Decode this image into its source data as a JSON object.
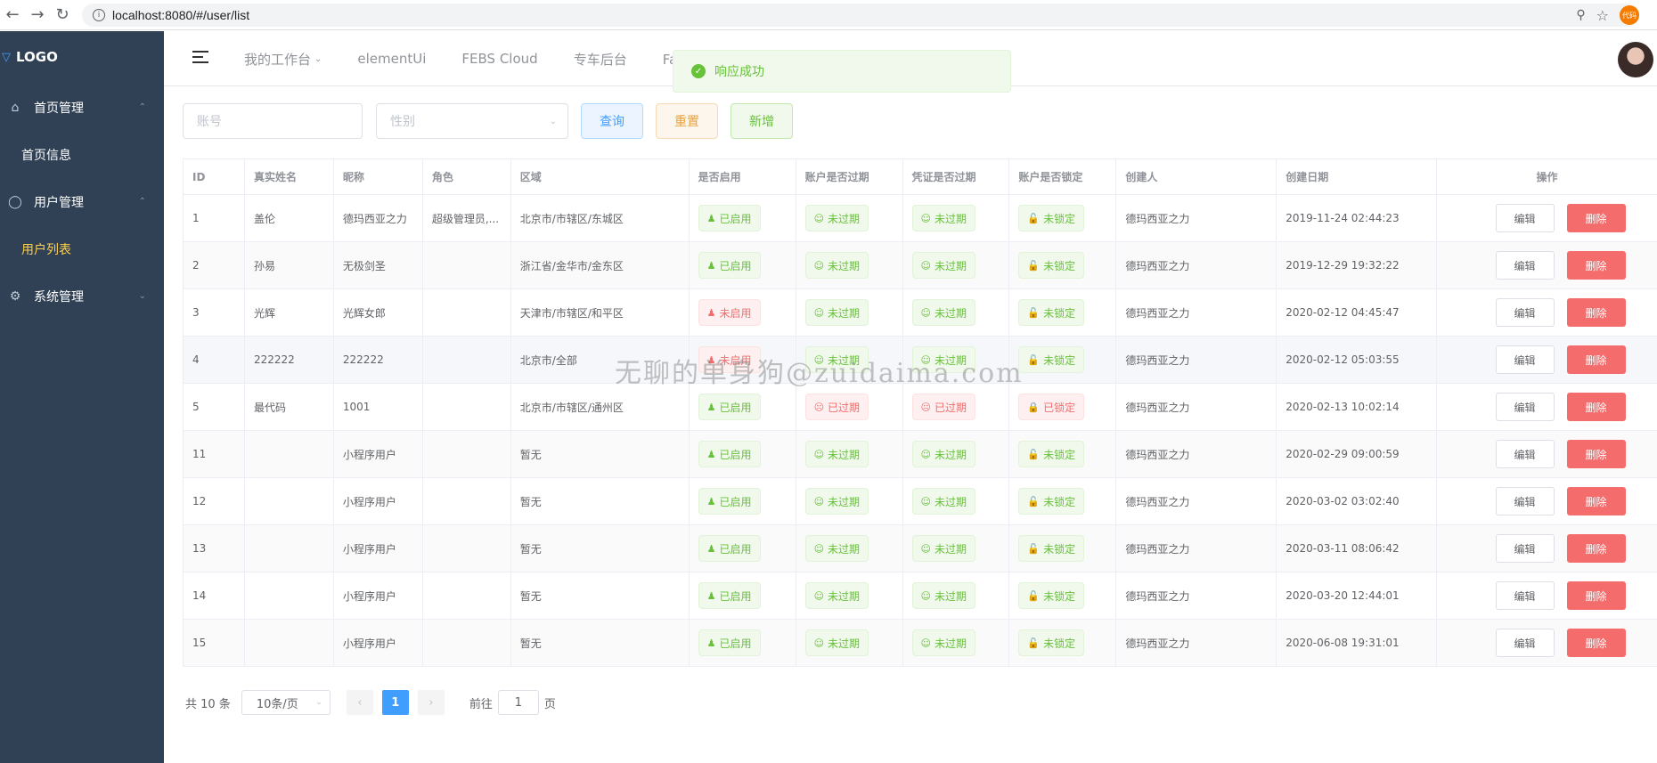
{
  "browser": {
    "url": "localhost:8080/#/user/list",
    "ext_label": "代码"
  },
  "sidebar": {
    "logo": "LOGO",
    "groups": [
      {
        "label": "首页管理",
        "items": [
          "首页信息"
        ]
      },
      {
        "label": "用户管理",
        "items": [
          "用户列表"
        ]
      },
      {
        "label": "系统管理",
        "items": []
      }
    ],
    "active_item": "用户列表"
  },
  "header": {
    "nav": [
      "我的工作台",
      "elementUi",
      "FEBS Cloud",
      "专车后台",
      "Fa图"
    ]
  },
  "toast": {
    "message": "响应成功"
  },
  "search": {
    "account_placeholder": "账号",
    "gender_placeholder": "性别",
    "query_label": "查询",
    "reset_label": "重置",
    "add_label": "新增"
  },
  "table": {
    "columns": [
      "ID",
      "真实姓名",
      "昵称",
      "角色",
      "区域",
      "是否启用",
      "账户是否过期",
      "凭证是否过期",
      "账户是否锁定",
      "创建人",
      "创建日期",
      "操作"
    ],
    "edit_label": "编辑",
    "delete_label": "删除",
    "rows": [
      {
        "id": "1",
        "real_name": "盖伦",
        "nickname": "德玛西亚之力",
        "role": "超级管理员,...",
        "area": "北京市/市辖区/东城区",
        "enabled": "已启用",
        "acct_expired": "未过期",
        "cred_expired": "未过期",
        "locked": "未锁定",
        "creator": "德玛西亚之力",
        "created": "2019-11-24 02:44:23"
      },
      {
        "id": "2",
        "real_name": "孙易",
        "nickname": "无极剑圣",
        "role": "",
        "area": "浙江省/金华市/金东区",
        "enabled": "已启用",
        "acct_expired": "未过期",
        "cred_expired": "未过期",
        "locked": "未锁定",
        "creator": "德玛西亚之力",
        "created": "2019-12-29 19:32:22"
      },
      {
        "id": "3",
        "real_name": "光辉",
        "nickname": "光辉女郎",
        "role": "",
        "area": "天津市/市辖区/和平区",
        "enabled": "未启用",
        "acct_expired": "未过期",
        "cred_expired": "未过期",
        "locked": "未锁定",
        "creator": "德玛西亚之力",
        "created": "2020-02-12 04:45:47"
      },
      {
        "id": "4",
        "real_name": "222222",
        "nickname": "222222",
        "role": "",
        "area": "北京市/全部",
        "enabled": "未启用",
        "acct_expired": "未过期",
        "cred_expired": "未过期",
        "locked": "未锁定",
        "creator": "德玛西亚之力",
        "created": "2020-02-12 05:03:55"
      },
      {
        "id": "5",
        "real_name": "最代码",
        "nickname": "1001",
        "role": "",
        "area": "北京市/市辖区/通州区",
        "enabled": "已启用",
        "acct_expired": "已过期",
        "cred_expired": "已过期",
        "locked": "已锁定",
        "creator": "德玛西亚之力",
        "created": "2020-02-13 10:02:14"
      },
      {
        "id": "11",
        "real_name": "",
        "nickname": "小程序用户",
        "role": "",
        "area": "暂无",
        "enabled": "已启用",
        "acct_expired": "未过期",
        "cred_expired": "未过期",
        "locked": "未锁定",
        "creator": "德玛西亚之力",
        "created": "2020-02-29 09:00:59"
      },
      {
        "id": "12",
        "real_name": "",
        "nickname": "小程序用户",
        "role": "",
        "area": "暂无",
        "enabled": "已启用",
        "acct_expired": "未过期",
        "cred_expired": "未过期",
        "locked": "未锁定",
        "creator": "德玛西亚之力",
        "created": "2020-03-02 03:02:40"
      },
      {
        "id": "13",
        "real_name": "",
        "nickname": "小程序用户",
        "role": "",
        "area": "暂无",
        "enabled": "已启用",
        "acct_expired": "未过期",
        "cred_expired": "未过期",
        "locked": "未锁定",
        "creator": "德玛西亚之力",
        "created": "2020-03-11 08:06:42"
      },
      {
        "id": "14",
        "real_name": "",
        "nickname": "小程序用户",
        "role": "",
        "area": "暂无",
        "enabled": "已启用",
        "acct_expired": "未过期",
        "cred_expired": "未过期",
        "locked": "未锁定",
        "creator": "德玛西亚之力",
        "created": "2020-03-20 12:44:01"
      },
      {
        "id": "15",
        "real_name": "",
        "nickname": "小程序用户",
        "role": "",
        "area": "暂无",
        "enabled": "已启用",
        "acct_expired": "未过期",
        "cred_expired": "未过期",
        "locked": "未锁定",
        "creator": "德玛西亚之力",
        "created": "2020-06-08 19:31:01"
      }
    ]
  },
  "pagination": {
    "total": "共 10 条",
    "page_size": "10条/页",
    "current": "1",
    "goto_prefix": "前往",
    "goto_value": "1",
    "goto_suffix": "页"
  },
  "watermark": "无聊的单身狗@zuidaima.com",
  "colors": {
    "sidebar_bg": "#304156",
    "active": "#ffd04b",
    "success": "#67c23a",
    "danger": "#f56c6c",
    "primary": "#409eff"
  }
}
